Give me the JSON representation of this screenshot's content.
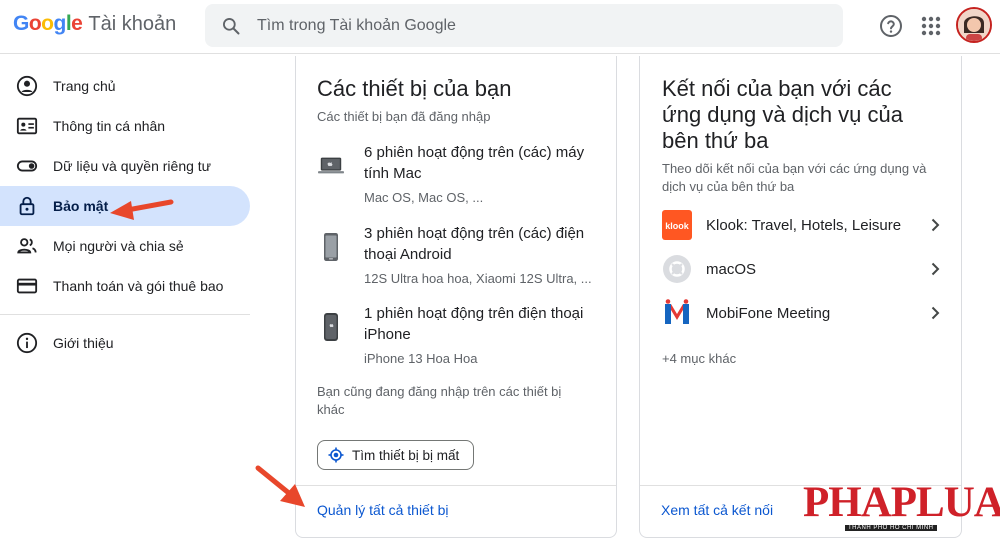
{
  "header": {
    "logo_text": "Google",
    "product_name": "Tài khoản",
    "search_placeholder": "Tìm trong Tài khoản Google",
    "icons": [
      "search-icon",
      "help-icon",
      "apps-icon"
    ]
  },
  "sidebar": {
    "items": [
      {
        "label": "Trang chủ",
        "icon": "home-icon"
      },
      {
        "label": "Thông tin cá nhân",
        "icon": "id-card-icon"
      },
      {
        "label": "Dữ liệu và quyền riêng tư",
        "icon": "toggle-icon"
      },
      {
        "label": "Bảo mật",
        "icon": "lock-icon",
        "active": true
      },
      {
        "label": "Mọi người và chia sẻ",
        "icon": "people-icon"
      },
      {
        "label": "Thanh toán và gói thuê bao",
        "icon": "credit-card-icon"
      }
    ],
    "footer_items": [
      {
        "label": "Giới thiệu",
        "icon": "info-icon"
      }
    ]
  },
  "devices_card": {
    "title": "Các thiết bị của bạn",
    "subtitle": "Các thiết bị bạn đã đăng nhập",
    "devices": [
      {
        "title": "6 phiên hoạt động trên (các) máy tính Mac",
        "desc": "Mac OS, Mac OS, ...",
        "icon": "laptop-icon"
      },
      {
        "title": "3 phiên hoạt động trên (các) điện thoại Android",
        "desc": "12S Ultra hoa hoa, Xiaomi 12S Ultra, ...",
        "icon": "android-phone-icon"
      },
      {
        "title": "1 phiên hoạt động trên điện thoại iPhone",
        "desc": "iPhone 13 Hoa Hoa",
        "icon": "iphone-icon"
      }
    ],
    "note": "Bạn cũng đang đăng nhập trên các thiết bị khác",
    "find_button": "Tìm thiết bị bị mất",
    "manage_link": "Quản lý tất cả thiết bị"
  },
  "connections_card": {
    "title": "Kết nối của bạn với các ứng dụng và dịch vụ của bên thứ ba",
    "subtitle": "Theo dõi kết nối của bạn với các ứng dụng và dịch vụ của bên thứ ba",
    "apps": [
      {
        "name": "Klook: Travel, Hotels, Leisure",
        "icon": "klook-icon",
        "icon_text": "klook"
      },
      {
        "name": "macOS",
        "icon": "macos-icon"
      },
      {
        "name": "MobiFone Meeting",
        "icon": "mobifone-icon"
      }
    ],
    "more": "+4 mục khác",
    "view_all_link": "Xem tất cả kết nối"
  },
  "watermark": {
    "text": "PHAPLUAT",
    "sub": "THÀNH PHỐ HỒ CHÍ MINH"
  },
  "colors": {
    "active_bg": "#d3e3fd",
    "link": "#0b57d0",
    "annotation_arrow": "#e8472b",
    "watermark": "#cf2129"
  }
}
